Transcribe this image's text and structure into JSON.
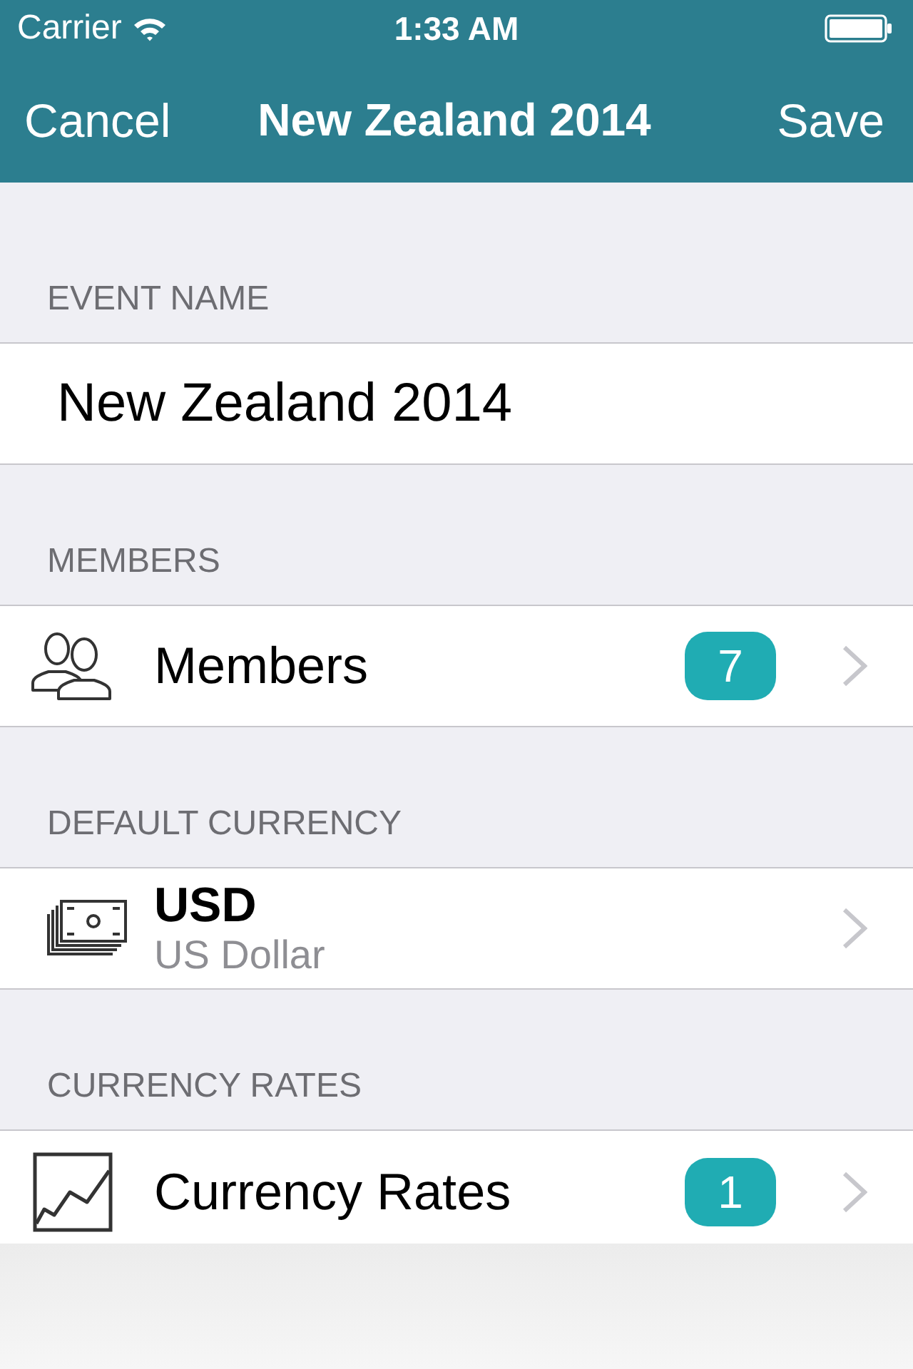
{
  "status_bar": {
    "carrier": "Carrier",
    "time": "1:33 AM"
  },
  "nav_bar": {
    "cancel": "Cancel",
    "title": "New Zealand 2014",
    "save": "Save"
  },
  "sections": [
    {
      "header": "EVENT NAME",
      "row": {
        "kind": "field",
        "value": "New Zealand 2014"
      }
    },
    {
      "header": "MEMBERS",
      "row": {
        "kind": "count",
        "label": "Members",
        "badge": "7"
      }
    },
    {
      "header": "DEFAULT CURRENCY",
      "row": {
        "kind": "detail",
        "label": "USD",
        "subtitle": "US Dollar"
      }
    },
    {
      "header": "CURRENCY RATES",
      "row": {
        "kind": "count",
        "label": "Currency Rates",
        "badge": "1"
      }
    }
  ]
}
